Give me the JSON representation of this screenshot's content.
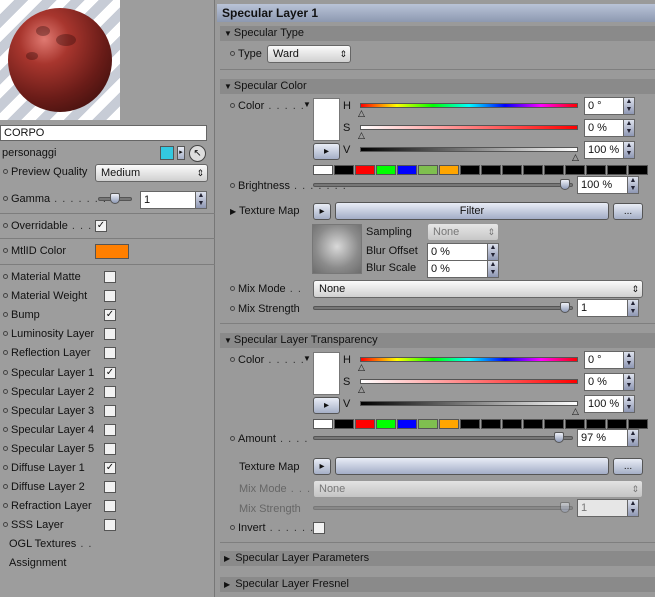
{
  "left": {
    "name_value": "CORPO",
    "group_label": "personaggi",
    "preview_quality": {
      "label": "Preview Quality",
      "value": "Medium"
    },
    "gamma": {
      "label": "Gamma",
      "value": "1"
    },
    "overridable": {
      "label": "Overridable",
      "checked": true
    },
    "mtlid": {
      "label": "MtlID Color",
      "color": "#ff7f00"
    },
    "layers": [
      {
        "label": "Material Matte",
        "checked": false
      },
      {
        "label": "Material Weight",
        "checked": false
      },
      {
        "label": "Bump",
        "checked": true
      },
      {
        "label": "Luminosity Layer",
        "checked": false
      },
      {
        "label": "Reflection Layer",
        "checked": false
      },
      {
        "label": "Specular Layer 1",
        "checked": true
      },
      {
        "label": "Specular Layer 2",
        "checked": false
      },
      {
        "label": "Specular Layer 3",
        "checked": false
      },
      {
        "label": "Specular Layer 4",
        "checked": false
      },
      {
        "label": "Specular Layer 5",
        "checked": false
      },
      {
        "label": "Diffuse Layer 1",
        "checked": true
      },
      {
        "label": "Diffuse Layer 2",
        "checked": false
      },
      {
        "label": "Refraction Layer",
        "checked": false
      },
      {
        "label": "SSS Layer",
        "checked": false
      }
    ],
    "ogl_textures": "OGL Textures",
    "assignment": "Assignment"
  },
  "right": {
    "title": "Specular Layer 1",
    "specular_type": {
      "header": "Specular Type",
      "type_label": "Type",
      "type_value": "Ward"
    },
    "specular_color": {
      "header": "Specular Color",
      "color_label": "Color",
      "h_label": "H",
      "h_value": "0 °",
      "s_label": "S",
      "s_value": "0 %",
      "v_label": "V",
      "v_value": "100 %",
      "brightness_label": "Brightness",
      "brightness_value": "100 %",
      "texture_map_label": "Texture Map",
      "filter_label": "Filter",
      "more_label": "...",
      "sampling_label": "Sampling",
      "sampling_value": "None",
      "blur_offset_label": "Blur Offset",
      "blur_offset_value": "0 %",
      "blur_scale_label": "Blur Scale",
      "blur_scale_value": "0 %",
      "mix_mode_label": "Mix Mode",
      "mix_mode_value": "None",
      "mix_strength_label": "Mix Strength",
      "mix_strength_value": "1"
    },
    "transparency": {
      "header": "Specular Layer Transparency",
      "color_label": "Color",
      "h_label": "H",
      "h_value": "0 °",
      "s_label": "S",
      "s_value": "0 %",
      "v_label": "V",
      "v_value": "100 %",
      "amount_label": "Amount",
      "amount_value": "97 %",
      "texture_map_label": "Texture Map",
      "more_label": "...",
      "mix_mode_label": "Mix Mode",
      "mix_mode_value": "None",
      "mix_strength_label": "Mix Strength",
      "mix_strength_value": "1",
      "invert_label": "Invert"
    },
    "collapsed_sections": [
      "Specular Layer Parameters",
      "Specular Layer Fresnel"
    ]
  },
  "swatch_colors": [
    "#ffffff",
    "#000000",
    "#ff0000",
    "#00ff00",
    "#0000ff",
    "#7fbf4f",
    "#ffa500",
    "#000000",
    "#000000",
    "#000000",
    "#000000",
    "#000000",
    "#000000",
    "#000000",
    "#000000",
    "#000000"
  ]
}
